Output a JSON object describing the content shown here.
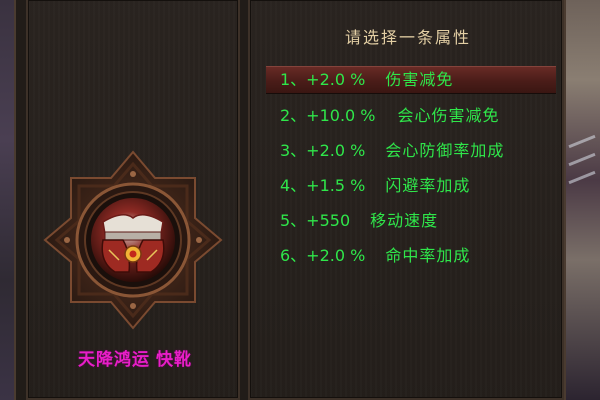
{
  "panel": {
    "title": "请选择一条属性"
  },
  "item": {
    "name_part1": "天降鸿运",
    "name_part2": "快靴"
  },
  "attributes": [
    {
      "value": "1、+2.0 %",
      "name": "伤害减免",
      "selected": true
    },
    {
      "value": "2、+10.0 %",
      "name": "会心伤害减免",
      "selected": false
    },
    {
      "value": "3、+2.0 %",
      "name": "会心防御率加成",
      "selected": false
    },
    {
      "value": "4、+1.5 %",
      "name": "闪避率加成",
      "selected": false
    },
    {
      "value": "5、+550",
      "name": "移动速度",
      "selected": false
    },
    {
      "value": "6、+2.0 %",
      "name": "命中率加成",
      "selected": false
    }
  ],
  "colors": {
    "attribute_text": "#2fe64a",
    "title_text": "#e3cfa4",
    "item_name": "#e81ec8",
    "selected_row": "#6a2c26"
  },
  "icons": {
    "item": "boots-item-icon",
    "frame": "ornate-octagonal-frame"
  }
}
